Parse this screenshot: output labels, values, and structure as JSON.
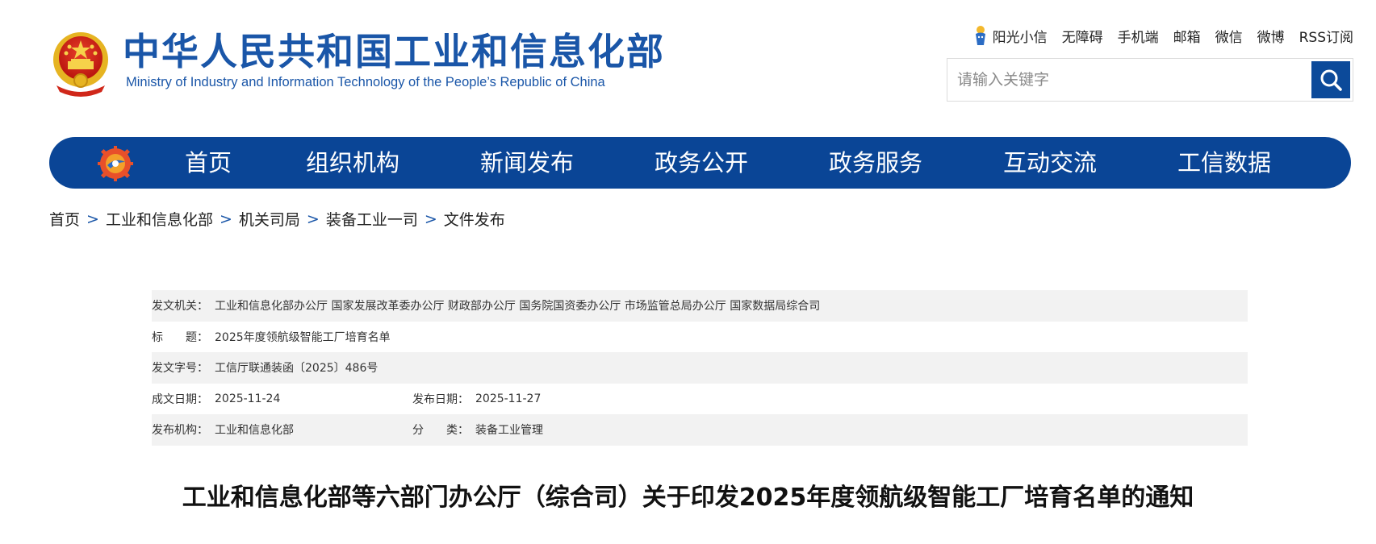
{
  "header": {
    "brand_cn": "中华人民共和国工业和信息化部",
    "brand_en": "Ministry of Industry and Information Technology of the People’s Republic of China",
    "links": [
      "阳光小信",
      "无障碍",
      "手机端",
      "邮箱",
      "微信",
      "微博",
      "RSS订阅"
    ],
    "search": {
      "placeholder": "请输入关键字"
    }
  },
  "nav": {
    "items": [
      "首页",
      "组织机构",
      "新闻发布",
      "政务公开",
      "政务服务",
      "互动交流",
      "工信数据"
    ]
  },
  "breadcrumb": {
    "items": [
      "首页",
      "工业和信息化部",
      "机关司局",
      "装备工业一司",
      "文件发布"
    ],
    "separator": ">"
  },
  "info": {
    "issuer_label": "发文机关：",
    "issuer": "工业和信息化部办公厅 国家发展改革委办公厅 财政部办公厅 国务院国资委办公厅 市场监管总局办公厅 国家数据局综合司",
    "title_label": "标　　题：",
    "title": "2025年度领航级智能工厂培育名单",
    "docno_label": "发文字号：",
    "docno": "工信厅联通装函〔2025〕486号",
    "created_label": "成文日期：",
    "created": "2025-11-24",
    "published_label": "发布日期：",
    "published": "2025-11-27",
    "org_label": "发布机构：",
    "org": "工业和信息化部",
    "category_label": "分　　类：",
    "category": "装备工业管理"
  },
  "document": {
    "title": "工业和信息化部等六部门办公厅（综合司）关于印发2025年度领航级智能工厂培育名单的通知"
  },
  "colors": {
    "brand_blue": "#0a4596",
    "text_blue": "#1a56a8",
    "row_alt": "#f2f2f2"
  }
}
